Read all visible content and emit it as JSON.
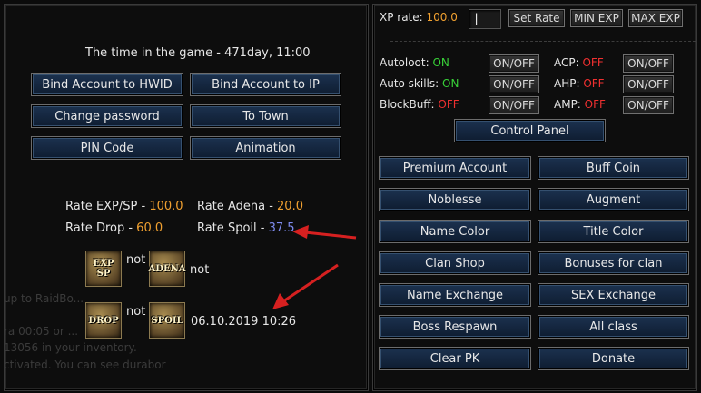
{
  "left": {
    "game_time": "The time in the game - 471day, 11:00",
    "buttons": {
      "bind_hwid": "Bind Account to HWID",
      "bind_ip": "Bind Account to IP",
      "change_password": "Change password",
      "to_town": "To Town",
      "pin_code": "PIN Code",
      "animation": "Animation"
    },
    "rates": {
      "exp_sp_label": "Rate EXP/SP - ",
      "exp_sp_value": "100.0",
      "adena_label": "Rate Adena - ",
      "adena_value": "20.0",
      "drop_label": "Rate Drop - ",
      "drop_value": "60.0",
      "spoil_label": "Rate Spoil - ",
      "spoil_value": "37.5"
    },
    "boosts": {
      "exp_sp_badge": "EXP SP",
      "exp_sp_status": "not",
      "adena_badge": "ADENA",
      "adena_status": "not",
      "drop_badge": "DROP",
      "drop_status": "not",
      "spoil_badge": "SPOIL",
      "spoil_status": "06.10.2019 10:26"
    },
    "background_chat": [
      "up to RaidBo...",
      "ra 00:05 or ...",
      "13056 in your inventory.",
      "ctivated. You can see durabor"
    ]
  },
  "right": {
    "xp_rate_label": "XP rate: ",
    "xp_rate_value": "100.0",
    "xp_input_value": "|",
    "set_rate": "Set Rate",
    "min_exp": "MIN EXP",
    "max_exp": "MAX EXP",
    "toggles": {
      "autoloot_label": "Autoloot: ",
      "autoloot_value": "ON",
      "acp_label": "ACP: ",
      "acp_value": "OFF",
      "auto_skills_label": "Auto skills: ",
      "auto_skills_value": "ON",
      "ahp_label": "AHP: ",
      "ahp_value": "OFF",
      "blockbuff_label": "BlockBuff: ",
      "blockbuff_value": "OFF",
      "amp_label": "AMP: ",
      "amp_value": "OFF",
      "toggle_button": "ON/OFF"
    },
    "control_panel": "Control Panel",
    "menu": [
      [
        "Premium Account",
        "Buff Coin"
      ],
      [
        "Noblesse",
        "Augment"
      ],
      [
        "Name Color",
        "Title Color"
      ],
      [
        "Clan Shop",
        "Bonuses for clan"
      ],
      [
        "Name Exchange",
        "SEX Exchange"
      ],
      [
        "Boss Respawn",
        "All class"
      ],
      [
        "Clear PK",
        "Donate"
      ]
    ]
  },
  "colors": {
    "accent_orange": "#f0a030",
    "on_green": "#38d038",
    "off_red": "#f03030",
    "spoil_blue": "#7f8cf0",
    "arrow_red": "#d62020"
  }
}
